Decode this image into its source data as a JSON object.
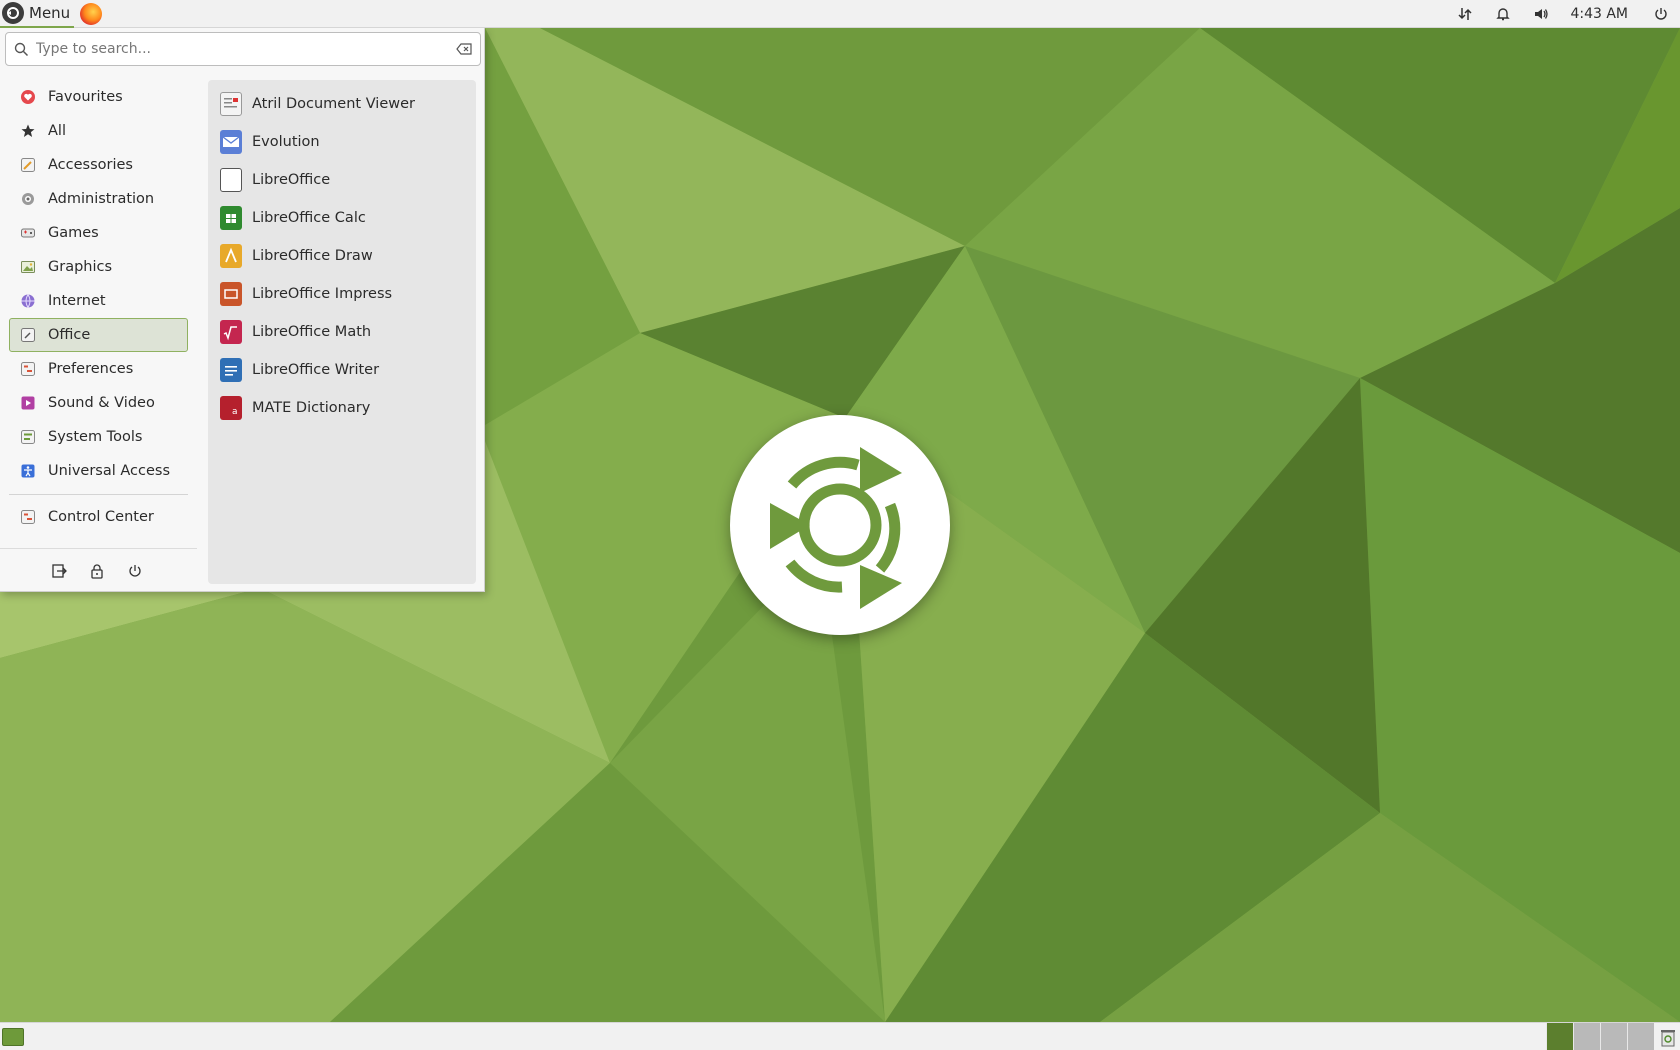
{
  "top_panel": {
    "menu_label": "Menu",
    "launcher_icon": "firefox-icon",
    "tray_icons": [
      "network-icon",
      "bell-icon",
      "volume-icon",
      "power-icon"
    ],
    "clock": "4:43 AM"
  },
  "search": {
    "placeholder": "Type to search...",
    "value": ""
  },
  "categories": [
    {
      "label": "Favourites",
      "icon": "heart-icon",
      "active": false
    },
    {
      "label": "All",
      "icon": "star-icon",
      "active": false
    },
    {
      "label": "Accessories",
      "icon": "accessories-icon",
      "active": false
    },
    {
      "label": "Administration",
      "icon": "administration-icon",
      "active": false
    },
    {
      "label": "Games",
      "icon": "games-icon",
      "active": false
    },
    {
      "label": "Graphics",
      "icon": "graphics-icon",
      "active": false
    },
    {
      "label": "Internet",
      "icon": "internet-icon",
      "active": false
    },
    {
      "label": "Office",
      "icon": "office-icon",
      "active": true
    },
    {
      "label": "Preferences",
      "icon": "preferences-icon",
      "active": false
    },
    {
      "label": "Sound & Video",
      "icon": "sound-video-icon",
      "active": false
    },
    {
      "label": "System Tools",
      "icon": "system-tools-icon",
      "active": false
    },
    {
      "label": "Universal Access",
      "icon": "universal-access-icon",
      "active": false
    }
  ],
  "control_center": {
    "label": "Control Center",
    "icon": "control-center-icon"
  },
  "session_actions": [
    "logout-icon",
    "lock-icon",
    "shutdown-icon"
  ],
  "apps": [
    {
      "label": "Atril Document Viewer",
      "icon": "atril-icon",
      "color": "#d8d8d8"
    },
    {
      "label": "Evolution",
      "icon": "evolution-icon",
      "color": "#5b7fd6"
    },
    {
      "label": "LibreOffice",
      "icon": "libreoffice-icon",
      "color": "#ffffff"
    },
    {
      "label": "LibreOffice Calc",
      "icon": "libreoffice-calc-icon",
      "color": "#2f8a2f"
    },
    {
      "label": "LibreOffice Draw",
      "icon": "libreoffice-draw-icon",
      "color": "#e8a92a"
    },
    {
      "label": "LibreOffice Impress",
      "icon": "libreoffice-impress-icon",
      "color": "#c9552a"
    },
    {
      "label": "LibreOffice Math",
      "icon": "libreoffice-math-icon",
      "color": "#c4264f"
    },
    {
      "label": "LibreOffice Writer",
      "icon": "libreoffice-writer-icon",
      "color": "#2f6fb5"
    },
    {
      "label": "MATE Dictionary",
      "icon": "dictionary-icon",
      "color": "#b5202d"
    }
  ],
  "workspaces": [
    {
      "name": "workspace-1",
      "active": true
    },
    {
      "name": "workspace-2",
      "active": false
    },
    {
      "name": "workspace-3",
      "active": false
    },
    {
      "name": "workspace-4",
      "active": false
    }
  ],
  "colors": {
    "accent": "#7ea64b",
    "wallpaper_base": "#6f9a3f",
    "panel": "#f1f1f1"
  }
}
